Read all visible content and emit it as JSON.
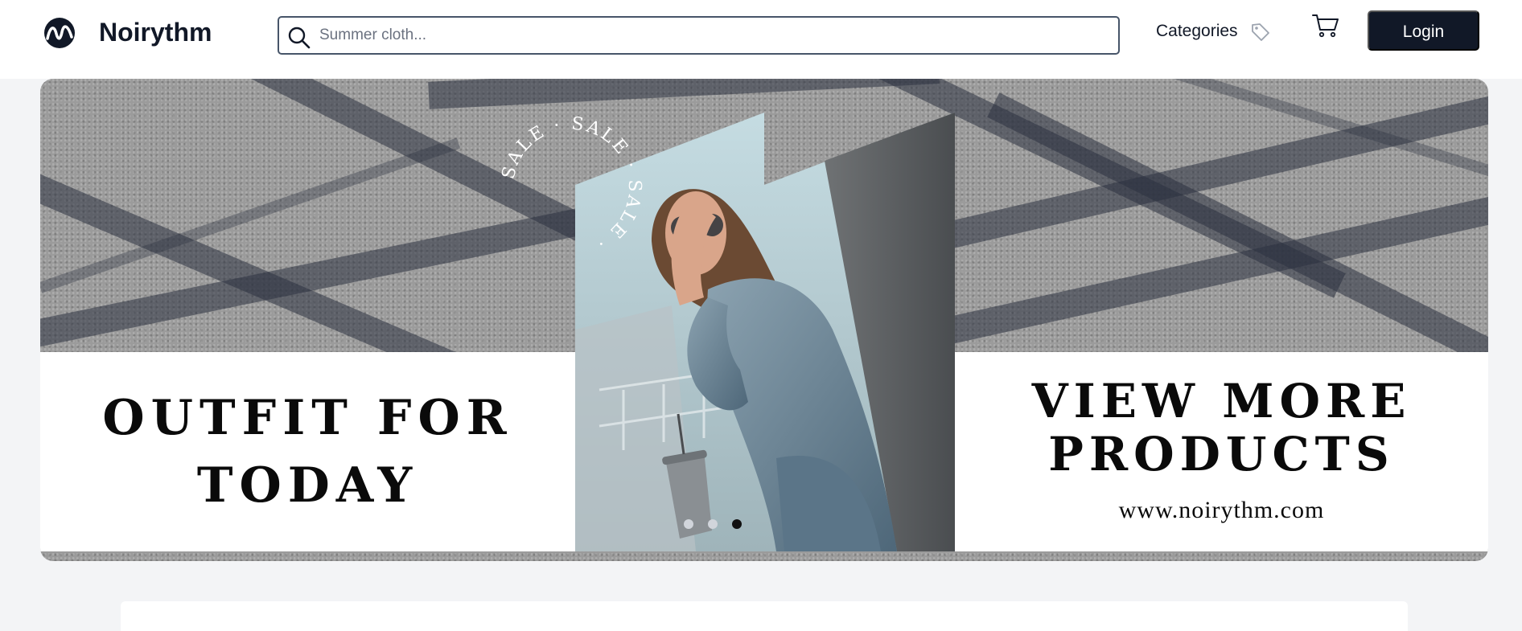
{
  "header": {
    "brand": "Noirythm",
    "search_placeholder": "Summer cloth...",
    "search_value": "",
    "categories_label": "Categories",
    "login_label": "Login",
    "icons": [
      "noirythm-logo",
      "search-icon",
      "tag-icon",
      "cart-icon"
    ]
  },
  "banner": {
    "headline_left_line1": "OUTFIT FOR",
    "headline_left_line2": "TODAY",
    "headline_right_line1": "VIEW MORE",
    "headline_right_line2": "PRODUCTS",
    "url": "www.noirythm.com",
    "sale_ring_text": "SALE · SALE · SALE ·",
    "carousel_dots": 3,
    "active_dot_index": 2
  },
  "colors": {
    "primary": "#111827",
    "page_background": "#f3f4f6",
    "header_background": "#ffffff",
    "search_border": "#475569"
  }
}
